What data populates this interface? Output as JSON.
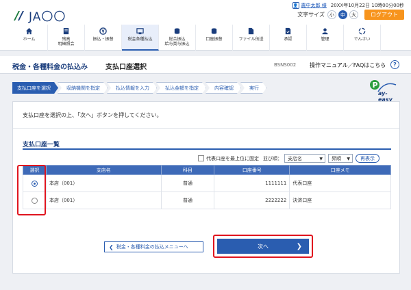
{
  "brand": {
    "logo_text": "JA〇〇"
  },
  "user": {
    "name": "農中太郎 様",
    "last_login": "20XX年10月22日 10時00分00秒"
  },
  "font_size": {
    "label": "文字サイズ",
    "small": "小",
    "medium": "中",
    "large": "大"
  },
  "logout_label": "ログアウト",
  "nav": [
    {
      "label": "ホーム",
      "icon": "home-icon"
    },
    {
      "label": "残高\n明細照会",
      "icon": "passbook-icon"
    },
    {
      "label": "振込・振替",
      "icon": "yen-transfer-icon"
    },
    {
      "label": "税金各種払込",
      "icon": "payment-icon"
    },
    {
      "label": "総合振込\n給与賞与振込",
      "icon": "coins-icon"
    },
    {
      "label": "口座振替",
      "icon": "coins-stack-icon"
    },
    {
      "label": "ファイル伝送",
      "icon": "file-transfer-icon"
    },
    {
      "label": "承認",
      "icon": "approval-icon"
    },
    {
      "label": "管理",
      "icon": "admin-icon"
    },
    {
      "label": "でんさい",
      "icon": "densai-icon"
    }
  ],
  "title": {
    "main": "税金・各種料金の払込み",
    "sub": "支払口座選択",
    "screen_id": "BSNS002",
    "manual": "操作マニュアル／FAQはこちら"
  },
  "steps": [
    "支払口座を選択",
    "収納機関を指定",
    "払込情報を入力",
    "払込金額を指定",
    "内容確認",
    "実行"
  ],
  "payeasy_text": "ay-easy",
  "instruction": "支払口座を選択の上、「次へ」ボタンを押してください。",
  "section_title": "支払口座一覧",
  "controls": {
    "checkbox_label": "代表口座を最上位に固定",
    "sort_label": "並び順：",
    "sort_field": "支店名",
    "sort_order": "昇順",
    "refresh": "再表示"
  },
  "table": {
    "headers": [
      "選択",
      "支店名",
      "科目",
      "口座番号",
      "口座メモ"
    ],
    "rows": [
      {
        "branch": "本店（001）",
        "subject": "普通",
        "number": "1111111",
        "memo": "代表口座",
        "selected": true
      },
      {
        "branch": "本店（001）",
        "subject": "普通",
        "number": "2222222",
        "memo": "決済口座",
        "selected": false
      }
    ]
  },
  "buttons": {
    "back": "税金・各種料金の払込メニューへ",
    "next": "次へ"
  },
  "colors": {
    "primary": "#2a5db0",
    "accent": "#f7941d",
    "highlight": "#e0141e"
  }
}
